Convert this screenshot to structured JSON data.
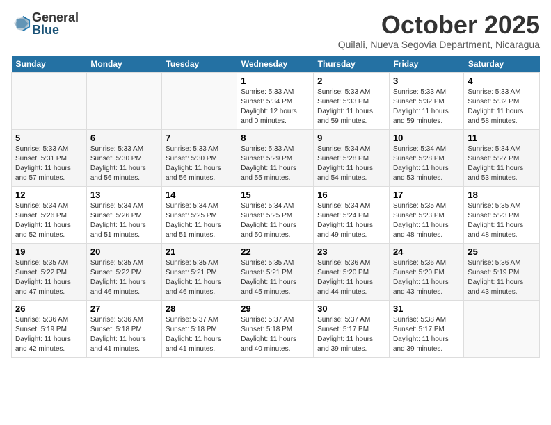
{
  "logo": {
    "general": "General",
    "blue": "Blue"
  },
  "title": "October 2025",
  "subtitle": "Quilali, Nueva Segovia Department, Nicaragua",
  "weekdays": [
    "Sunday",
    "Monday",
    "Tuesday",
    "Wednesday",
    "Thursday",
    "Friday",
    "Saturday"
  ],
  "weeks": [
    [
      {
        "day": "",
        "info": ""
      },
      {
        "day": "",
        "info": ""
      },
      {
        "day": "",
        "info": ""
      },
      {
        "day": "1",
        "info": "Sunrise: 5:33 AM\nSunset: 5:34 PM\nDaylight: 12 hours and 0 minutes."
      },
      {
        "day": "2",
        "info": "Sunrise: 5:33 AM\nSunset: 5:33 PM\nDaylight: 11 hours and 59 minutes."
      },
      {
        "day": "3",
        "info": "Sunrise: 5:33 AM\nSunset: 5:32 PM\nDaylight: 11 hours and 59 minutes."
      },
      {
        "day": "4",
        "info": "Sunrise: 5:33 AM\nSunset: 5:32 PM\nDaylight: 11 hours and 58 minutes."
      }
    ],
    [
      {
        "day": "5",
        "info": "Sunrise: 5:33 AM\nSunset: 5:31 PM\nDaylight: 11 hours and 57 minutes."
      },
      {
        "day": "6",
        "info": "Sunrise: 5:33 AM\nSunset: 5:30 PM\nDaylight: 11 hours and 56 minutes."
      },
      {
        "day": "7",
        "info": "Sunrise: 5:33 AM\nSunset: 5:30 PM\nDaylight: 11 hours and 56 minutes."
      },
      {
        "day": "8",
        "info": "Sunrise: 5:33 AM\nSunset: 5:29 PM\nDaylight: 11 hours and 55 minutes."
      },
      {
        "day": "9",
        "info": "Sunrise: 5:34 AM\nSunset: 5:28 PM\nDaylight: 11 hours and 54 minutes."
      },
      {
        "day": "10",
        "info": "Sunrise: 5:34 AM\nSunset: 5:28 PM\nDaylight: 11 hours and 53 minutes."
      },
      {
        "day": "11",
        "info": "Sunrise: 5:34 AM\nSunset: 5:27 PM\nDaylight: 11 hours and 53 minutes."
      }
    ],
    [
      {
        "day": "12",
        "info": "Sunrise: 5:34 AM\nSunset: 5:26 PM\nDaylight: 11 hours and 52 minutes."
      },
      {
        "day": "13",
        "info": "Sunrise: 5:34 AM\nSunset: 5:26 PM\nDaylight: 11 hours and 51 minutes."
      },
      {
        "day": "14",
        "info": "Sunrise: 5:34 AM\nSunset: 5:25 PM\nDaylight: 11 hours and 51 minutes."
      },
      {
        "day": "15",
        "info": "Sunrise: 5:34 AM\nSunset: 5:25 PM\nDaylight: 11 hours and 50 minutes."
      },
      {
        "day": "16",
        "info": "Sunrise: 5:34 AM\nSunset: 5:24 PM\nDaylight: 11 hours and 49 minutes."
      },
      {
        "day": "17",
        "info": "Sunrise: 5:35 AM\nSunset: 5:23 PM\nDaylight: 11 hours and 48 minutes."
      },
      {
        "day": "18",
        "info": "Sunrise: 5:35 AM\nSunset: 5:23 PM\nDaylight: 11 hours and 48 minutes."
      }
    ],
    [
      {
        "day": "19",
        "info": "Sunrise: 5:35 AM\nSunset: 5:22 PM\nDaylight: 11 hours and 47 minutes."
      },
      {
        "day": "20",
        "info": "Sunrise: 5:35 AM\nSunset: 5:22 PM\nDaylight: 11 hours and 46 minutes."
      },
      {
        "day": "21",
        "info": "Sunrise: 5:35 AM\nSunset: 5:21 PM\nDaylight: 11 hours and 46 minutes."
      },
      {
        "day": "22",
        "info": "Sunrise: 5:35 AM\nSunset: 5:21 PM\nDaylight: 11 hours and 45 minutes."
      },
      {
        "day": "23",
        "info": "Sunrise: 5:36 AM\nSunset: 5:20 PM\nDaylight: 11 hours and 44 minutes."
      },
      {
        "day": "24",
        "info": "Sunrise: 5:36 AM\nSunset: 5:20 PM\nDaylight: 11 hours and 43 minutes."
      },
      {
        "day": "25",
        "info": "Sunrise: 5:36 AM\nSunset: 5:19 PM\nDaylight: 11 hours and 43 minutes."
      }
    ],
    [
      {
        "day": "26",
        "info": "Sunrise: 5:36 AM\nSunset: 5:19 PM\nDaylight: 11 hours and 42 minutes."
      },
      {
        "day": "27",
        "info": "Sunrise: 5:36 AM\nSunset: 5:18 PM\nDaylight: 11 hours and 41 minutes."
      },
      {
        "day": "28",
        "info": "Sunrise: 5:37 AM\nSunset: 5:18 PM\nDaylight: 11 hours and 41 minutes."
      },
      {
        "day": "29",
        "info": "Sunrise: 5:37 AM\nSunset: 5:18 PM\nDaylight: 11 hours and 40 minutes."
      },
      {
        "day": "30",
        "info": "Sunrise: 5:37 AM\nSunset: 5:17 PM\nDaylight: 11 hours and 39 minutes."
      },
      {
        "day": "31",
        "info": "Sunrise: 5:38 AM\nSunset: 5:17 PM\nDaylight: 11 hours and 39 minutes."
      },
      {
        "day": "",
        "info": ""
      }
    ]
  ]
}
